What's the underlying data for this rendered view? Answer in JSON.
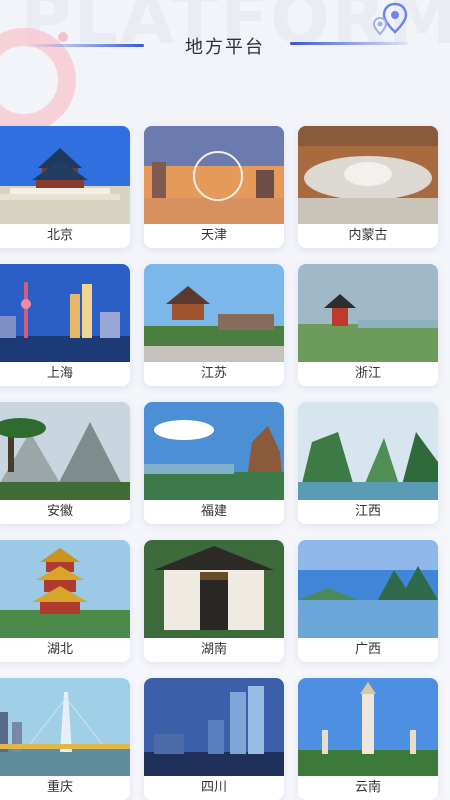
{
  "header": {
    "watermark": "PLATFORM",
    "title": "地方平台",
    "pin_icon": "location-pin-icon"
  },
  "colors": {
    "accent": "#3a56d8",
    "card_bg": "#ffffff",
    "page_bg": "#f4f6fb"
  },
  "regions": [
    {
      "label": "北京",
      "scene": "temple"
    },
    {
      "label": "天津",
      "scene": "ferris"
    },
    {
      "label": "内蒙古",
      "scene": "dome"
    },
    {
      "label": "上海",
      "scene": "skyline"
    },
    {
      "label": "江苏",
      "scene": "tower"
    },
    {
      "label": "浙江",
      "scene": "pavilion"
    },
    {
      "label": "安徽",
      "scene": "pine"
    },
    {
      "label": "福建",
      "scene": "rock"
    },
    {
      "label": "江西",
      "scene": "karst"
    },
    {
      "label": "湖北",
      "scene": "pagoda"
    },
    {
      "label": "湖南",
      "scene": "academy"
    },
    {
      "label": "广西",
      "scene": "river"
    },
    {
      "label": "重庆",
      "scene": "bridge"
    },
    {
      "label": "四川",
      "scene": "city"
    },
    {
      "label": "云南",
      "scene": "stupa"
    }
  ]
}
